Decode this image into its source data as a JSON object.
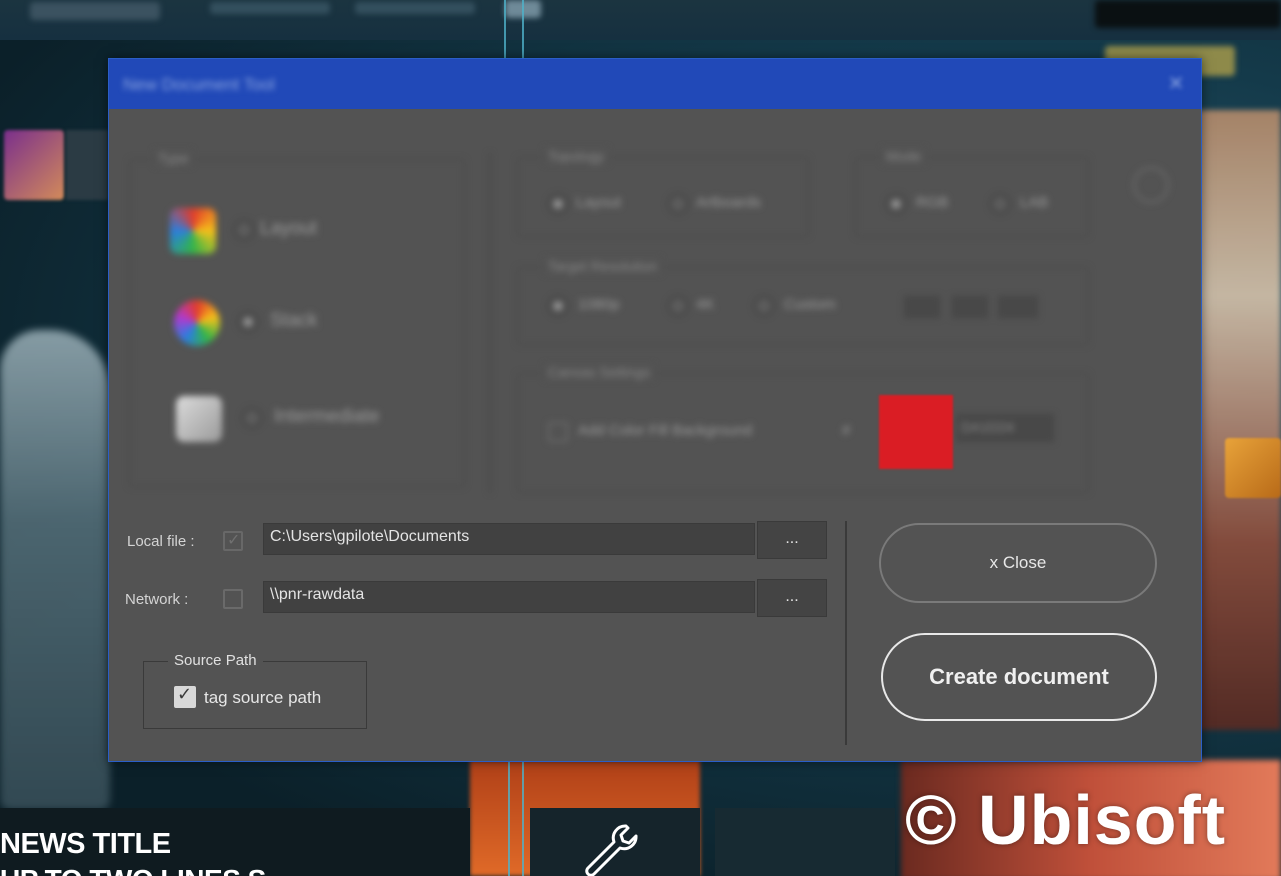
{
  "background": {
    "news_title_line1": "NEWS TITLE",
    "news_title_line2": "UP TO TWO LINES S",
    "copyright": "© Ubisoft",
    "wrench_icon": "wrench-icon"
  },
  "dialog": {
    "title": "New Document Tool",
    "close_glyph": "✕",
    "type_group": {
      "label": "Type",
      "options": [
        {
          "label": "Layout"
        },
        {
          "label": "Stack"
        },
        {
          "label": "Intermediate"
        }
      ]
    },
    "topology_group": {
      "label": "Topology",
      "options": [
        "Layout",
        "Artboards"
      ]
    },
    "mode_group": {
      "label": "Mode",
      "options": [
        "RGB",
        "LAB"
      ]
    },
    "resolution_group": {
      "label": "Target Resolution",
      "options": [
        "1080p",
        "4K",
        "Custom"
      ]
    },
    "canvas_group": {
      "label": "Canvas Settings",
      "fill_label": "Add Color Fill Background",
      "hash": "#",
      "hex_value": "DA1D24",
      "swatch_color": "#DA1D24"
    },
    "paths": {
      "local_label": "Local file :",
      "local_value": "C:\\Users\\gpilote\\Documents",
      "network_label": "Network :",
      "network_value": "\\\\pnr-rawdata",
      "browse_label": "..."
    },
    "source_path": {
      "legend": "Source Path",
      "tag_label": "tag source path",
      "checked": true
    },
    "buttons": {
      "close_label": "x Close",
      "create_label": "Create document"
    }
  }
}
